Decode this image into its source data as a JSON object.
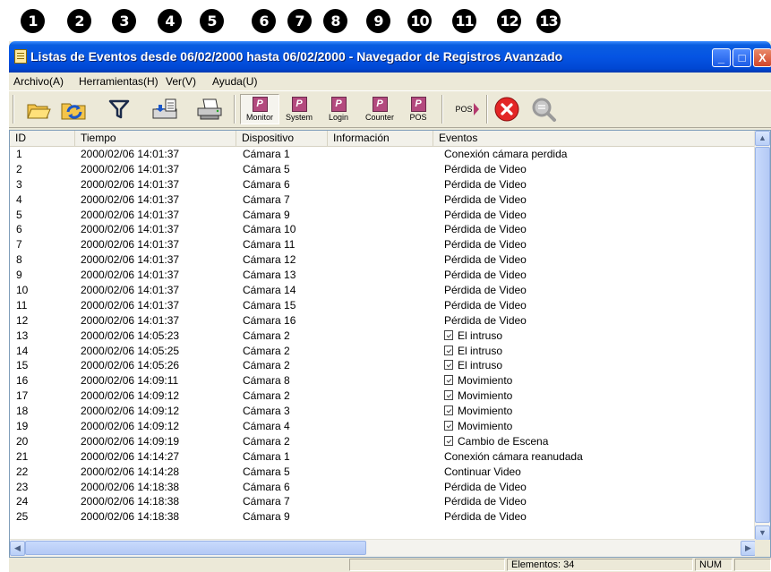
{
  "callouts": [
    "1",
    "2",
    "3",
    "4",
    "5",
    "6",
    "7",
    "8",
    "9",
    "10",
    "11",
    "12",
    "13"
  ],
  "window": {
    "title": "Listas de Eventos desde 06/02/2000 hasta 06/02/2000 - Navegador de Registros Avanzado",
    "controls": {
      "minimize": "_",
      "maximize": "□",
      "close": "X"
    }
  },
  "menu": [
    "Archivo(A)",
    "Herramientas(H)",
    "Ver(V)",
    "Ayuda(U)"
  ],
  "toolbar": {
    "open_icon": "folder-open-icon",
    "refresh_icon": "folder-refresh-icon",
    "filter_icon": "filter-funnel-icon",
    "export_icon": "export-icon",
    "print_icon": "printer-icon",
    "log_buttons": [
      "Monitor",
      "System",
      "Login",
      "Counter",
      "POS"
    ],
    "pos_view_label": "POS",
    "close_icon": "close-red-icon",
    "search_icon": "magnifier-disabled-icon"
  },
  "table": {
    "columns": [
      "ID",
      "Tiempo",
      "Dispositivo",
      "Información",
      "Eventos"
    ],
    "rows": [
      {
        "id": "1",
        "time": "2000/02/06 14:01:37",
        "device": "Cámara 1",
        "info": "",
        "event": "Conexión cámara perdida",
        "icon": false
      },
      {
        "id": "2",
        "time": "2000/02/06 14:01:37",
        "device": "Cámara 5",
        "info": "",
        "event": "Pérdida de Video",
        "icon": false
      },
      {
        "id": "3",
        "time": "2000/02/06 14:01:37",
        "device": "Cámara 6",
        "info": "",
        "event": "Pérdida de Video",
        "icon": false
      },
      {
        "id": "4",
        "time": "2000/02/06 14:01:37",
        "device": "Cámara 7",
        "info": "",
        "event": "Pérdida de Video",
        "icon": false
      },
      {
        "id": "5",
        "time": "2000/02/06 14:01:37",
        "device": "Cámara 9",
        "info": "",
        "event": "Pérdida de Video",
        "icon": false
      },
      {
        "id": "6",
        "time": "2000/02/06 14:01:37",
        "device": "Cámara 10",
        "info": "",
        "event": "Pérdida de Video",
        "icon": false
      },
      {
        "id": "7",
        "time": "2000/02/06 14:01:37",
        "device": "Cámara 11",
        "info": "",
        "event": "Pérdida de Video",
        "icon": false
      },
      {
        "id": "8",
        "time": "2000/02/06 14:01:37",
        "device": "Cámara 12",
        "info": "",
        "event": "Pérdida de Video",
        "icon": false
      },
      {
        "id": "9",
        "time": "2000/02/06 14:01:37",
        "device": "Cámara 13",
        "info": "",
        "event": "Pérdida de Video",
        "icon": false
      },
      {
        "id": "10",
        "time": "2000/02/06 14:01:37",
        "device": "Cámara 14",
        "info": "",
        "event": "Pérdida de Video",
        "icon": false
      },
      {
        "id": "11",
        "time": "2000/02/06 14:01:37",
        "device": "Cámara 15",
        "info": "",
        "event": "Pérdida de Video",
        "icon": false
      },
      {
        "id": "12",
        "time": "2000/02/06 14:01:37",
        "device": "Cámara 16",
        "info": "",
        "event": "Pérdida de Video",
        "icon": false
      },
      {
        "id": "13",
        "time": "2000/02/06 14:05:23",
        "device": "Cámara 2",
        "info": "",
        "event": "El intruso",
        "icon": true
      },
      {
        "id": "14",
        "time": "2000/02/06 14:05:25",
        "device": "Cámara 2",
        "info": "",
        "event": "El intruso",
        "icon": true
      },
      {
        "id": "15",
        "time": "2000/02/06 14:05:26",
        "device": "Cámara 2",
        "info": "",
        "event": "El intruso",
        "icon": true
      },
      {
        "id": "16",
        "time": "2000/02/06 14:09:11",
        "device": "Cámara 8",
        "info": "",
        "event": "Movimiento",
        "icon": true
      },
      {
        "id": "17",
        "time": "2000/02/06 14:09:12",
        "device": "Cámara 2",
        "info": "",
        "event": "Movimiento",
        "icon": true
      },
      {
        "id": "18",
        "time": "2000/02/06 14:09:12",
        "device": "Cámara 3",
        "info": "",
        "event": "Movimiento",
        "icon": true
      },
      {
        "id": "19",
        "time": "2000/02/06 14:09:12",
        "device": "Cámara 4",
        "info": "",
        "event": "Movimiento",
        "icon": true
      },
      {
        "id": "20",
        "time": "2000/02/06 14:09:19",
        "device": "Cámara 2",
        "info": "",
        "event": "Cambio de Escena",
        "icon": true
      },
      {
        "id": "21",
        "time": "2000/02/06 14:14:27",
        "device": "Cámara 1",
        "info": "",
        "event": "Conexión cámara reanudada",
        "icon": false
      },
      {
        "id": "22",
        "time": "2000/02/06 14:14:28",
        "device": "Cámara 5",
        "info": "",
        "event": "Continuar Video",
        "icon": false
      },
      {
        "id": "23",
        "time": "2000/02/06 14:18:38",
        "device": "Cámara 6",
        "info": "",
        "event": "Pérdida de Video",
        "icon": false
      },
      {
        "id": "24",
        "time": "2000/02/06 14:18:38",
        "device": "Cámara 7",
        "info": "",
        "event": "Pérdida de Video",
        "icon": false
      },
      {
        "id": "25",
        "time": "2000/02/06 14:18:38",
        "device": "Cámara 9",
        "info": "",
        "event": "Pérdida de Video",
        "icon": false
      }
    ]
  },
  "status": {
    "items": "Elementos: 34",
    "num": "NUM"
  }
}
